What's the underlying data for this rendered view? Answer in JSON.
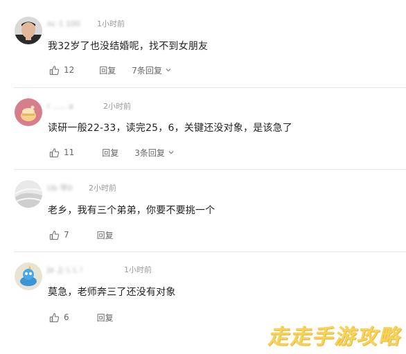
{
  "comments": [
    {
      "username": "nc 1 100",
      "time": "1小时前",
      "text": "我32岁了也没结婚呢，找不到女朋友",
      "likes": "12",
      "reply_label": "回复",
      "replies_label": "7条回复"
    },
    {
      "username": "l  ...... a",
      "time": "2小时前",
      "text": "读研一般22-33，读完25，6，关键还没对象，是该急了",
      "likes": "11",
      "reply_label": "回复",
      "replies_label": "3条回复"
    },
    {
      "username": "Ub 早0",
      "time": "2小时前",
      "text": "老乡，我有三个弟弟，你要不要挑一个",
      "likes": "7",
      "reply_label": "回复"
    },
    {
      "username": "Ja 上 L L !",
      "time": "1小时前",
      "text": "莫急，老师奔三了还没有对象",
      "likes": "6",
      "reply_label": "回复"
    }
  ],
  "watermark": "走走手游攻略",
  "icons": {
    "like": "thumbs-up-icon",
    "expand": "chevron-down-icon"
  },
  "colors": {
    "text": "#222222",
    "meta": "#999999",
    "action": "#666666",
    "watermark": "#f6cf4a"
  }
}
